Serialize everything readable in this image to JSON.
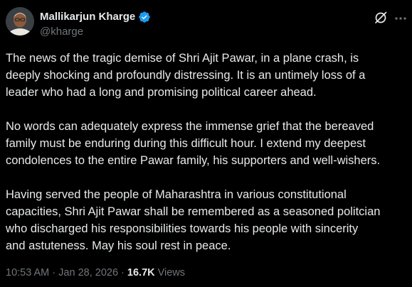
{
  "author": {
    "display_name": "Mallikarjun Kharge",
    "handle": "@kharge",
    "verified": true,
    "verified_color": "#1d9bf0"
  },
  "icons": {
    "verified": "verified-badge-icon",
    "grok": "grok-icon",
    "more": "more-options-icon"
  },
  "tweet": {
    "paragraphs": [
      [
        "The news of the tragic demise of Shri Ajit Pawar, in a plane crash, is",
        "deeply shocking and profoundly distressing. It is an untimely loss of a",
        "leader who had a long and promising political career ahead."
      ],
      [
        "No words can adequately express the immense grief that the bereaved",
        "family must be enduring during this difficult hour. I extend my deepest",
        "condolences to the entire Pawar family, his supporters and well-wishers."
      ],
      [
        "Having served the people of Maharashtra in various constitutional",
        "capacities, Shri Ajit Pawar shall be remembered as a seasoned politcian",
        "who discharged his responsibilities towards his people with sincerity",
        "and astuteness. May his soul rest in peace."
      ]
    ]
  },
  "meta": {
    "time": "10:53 AM",
    "separator": " · ",
    "date": "Jan 28, 2026",
    "views_count": "16.7K",
    "views_label": " Views"
  },
  "colors": {
    "background": "#000000",
    "text_primary": "#e7e9ea",
    "text_secondary": "#71767b"
  }
}
